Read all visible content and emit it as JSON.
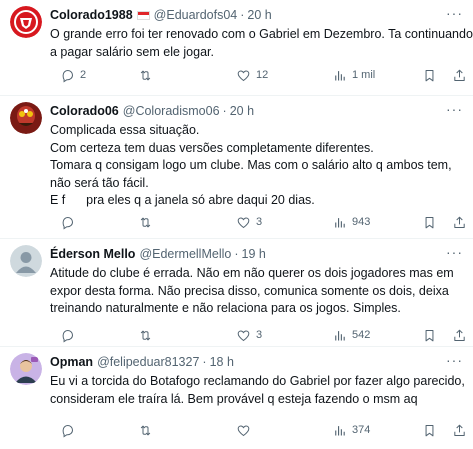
{
  "colors": {
    "text": "#0f1419",
    "muted": "#536471",
    "divider": "#eff3f4"
  },
  "tweets": [
    {
      "name": "Colorado1988",
      "handle": "@Eduardofs04",
      "time": "20 h",
      "lines": [
        "O grande erro foi ter renovado com o Gabriel em Dezembro. Ta continuando",
        "a pagar salário sem ele jogar."
      ],
      "replies": "2",
      "retweets": "",
      "likes": "12",
      "views": "1 mil"
    },
    {
      "name": "Colorado06",
      "handle": "@Coloradismo06",
      "time": "20 h",
      "lines": [
        "Complicada essa situação.",
        "Com certeza tem duas versões completamente diferentes.",
        "Tomara q consigam logo um clube. Mas com o salário alto q ambos tem,",
        "não será tão fácil.",
        "E f      pra eles q a janela só abre daqui 20 dias."
      ],
      "replies": "",
      "retweets": "",
      "likes": "3",
      "views": "943"
    },
    {
      "name": "Éderson Mello",
      "handle": "@EdermellMello",
      "time": "19 h",
      "lines": [
        "Atitude do clube é errada. Não em não querer os dois jogadores mas em",
        "expor desta forma. Não precisa disso, comunica somente os dois, deixa",
        "treinando naturalmente e não relaciona para os jogos. Simples."
      ],
      "replies": "",
      "retweets": "",
      "likes": "3",
      "views": "542"
    },
    {
      "name": "Opman",
      "handle": "@felipeduar81327",
      "time": "18 h",
      "lines": [
        "Eu vi a torcida do Botafogo reclamando do Gabriel por fazer algo parecido,",
        "consideram ele traíra lá. Bem provável q esteja fazendo o msm aq"
      ],
      "replies": "",
      "retweets": "",
      "likes": "",
      "views": "374"
    }
  ],
  "separator": "·",
  "more_glyph": "···"
}
